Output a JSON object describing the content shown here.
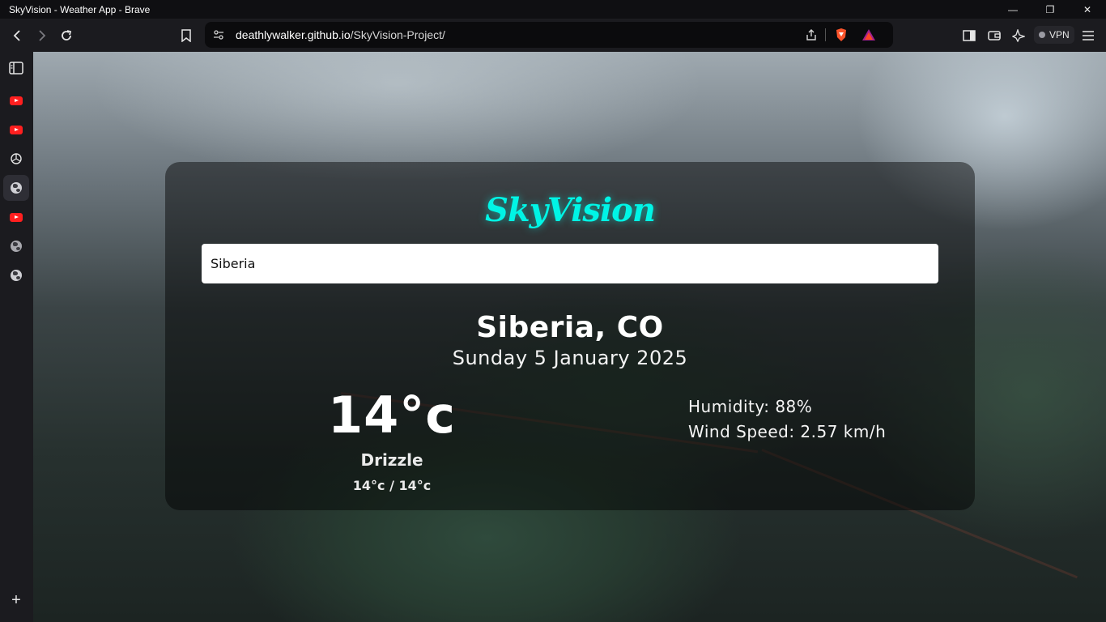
{
  "window": {
    "title": "SkyVision - Weather App - Brave",
    "controls": {
      "minimize": "—",
      "restore": "❐",
      "close": "✕"
    }
  },
  "toolbar": {
    "url_host": "deathlywalker.github.io",
    "url_path": "/SkyVision-Project/",
    "vpn_label": "VPN"
  },
  "sidebar": {
    "items": [
      {
        "icon": "sidebar-panel-icon"
      },
      {
        "icon": "youtube-icon"
      },
      {
        "icon": "youtube-icon"
      },
      {
        "icon": "openai-icon"
      },
      {
        "icon": "globe-icon",
        "active": true
      },
      {
        "icon": "youtube-icon"
      },
      {
        "icon": "globe-icon"
      },
      {
        "icon": "globe-icon"
      }
    ],
    "add_label": "+"
  },
  "app": {
    "logo": "SkyVision",
    "search_value": "Siberia",
    "city": "Siberia, CO",
    "date": "Sunday 5 January 2025",
    "temperature": "14°c",
    "condition": "Drizzle",
    "range": "14°c / 14°c",
    "humidity": "Humidity: 88%",
    "wind": "Wind Speed: 2.57 km/h"
  },
  "colors": {
    "logo_accent": "#00f5e6",
    "card_background": "rgba(0,0,0,0.45)",
    "browser_chrome": "#1b1b1f"
  }
}
